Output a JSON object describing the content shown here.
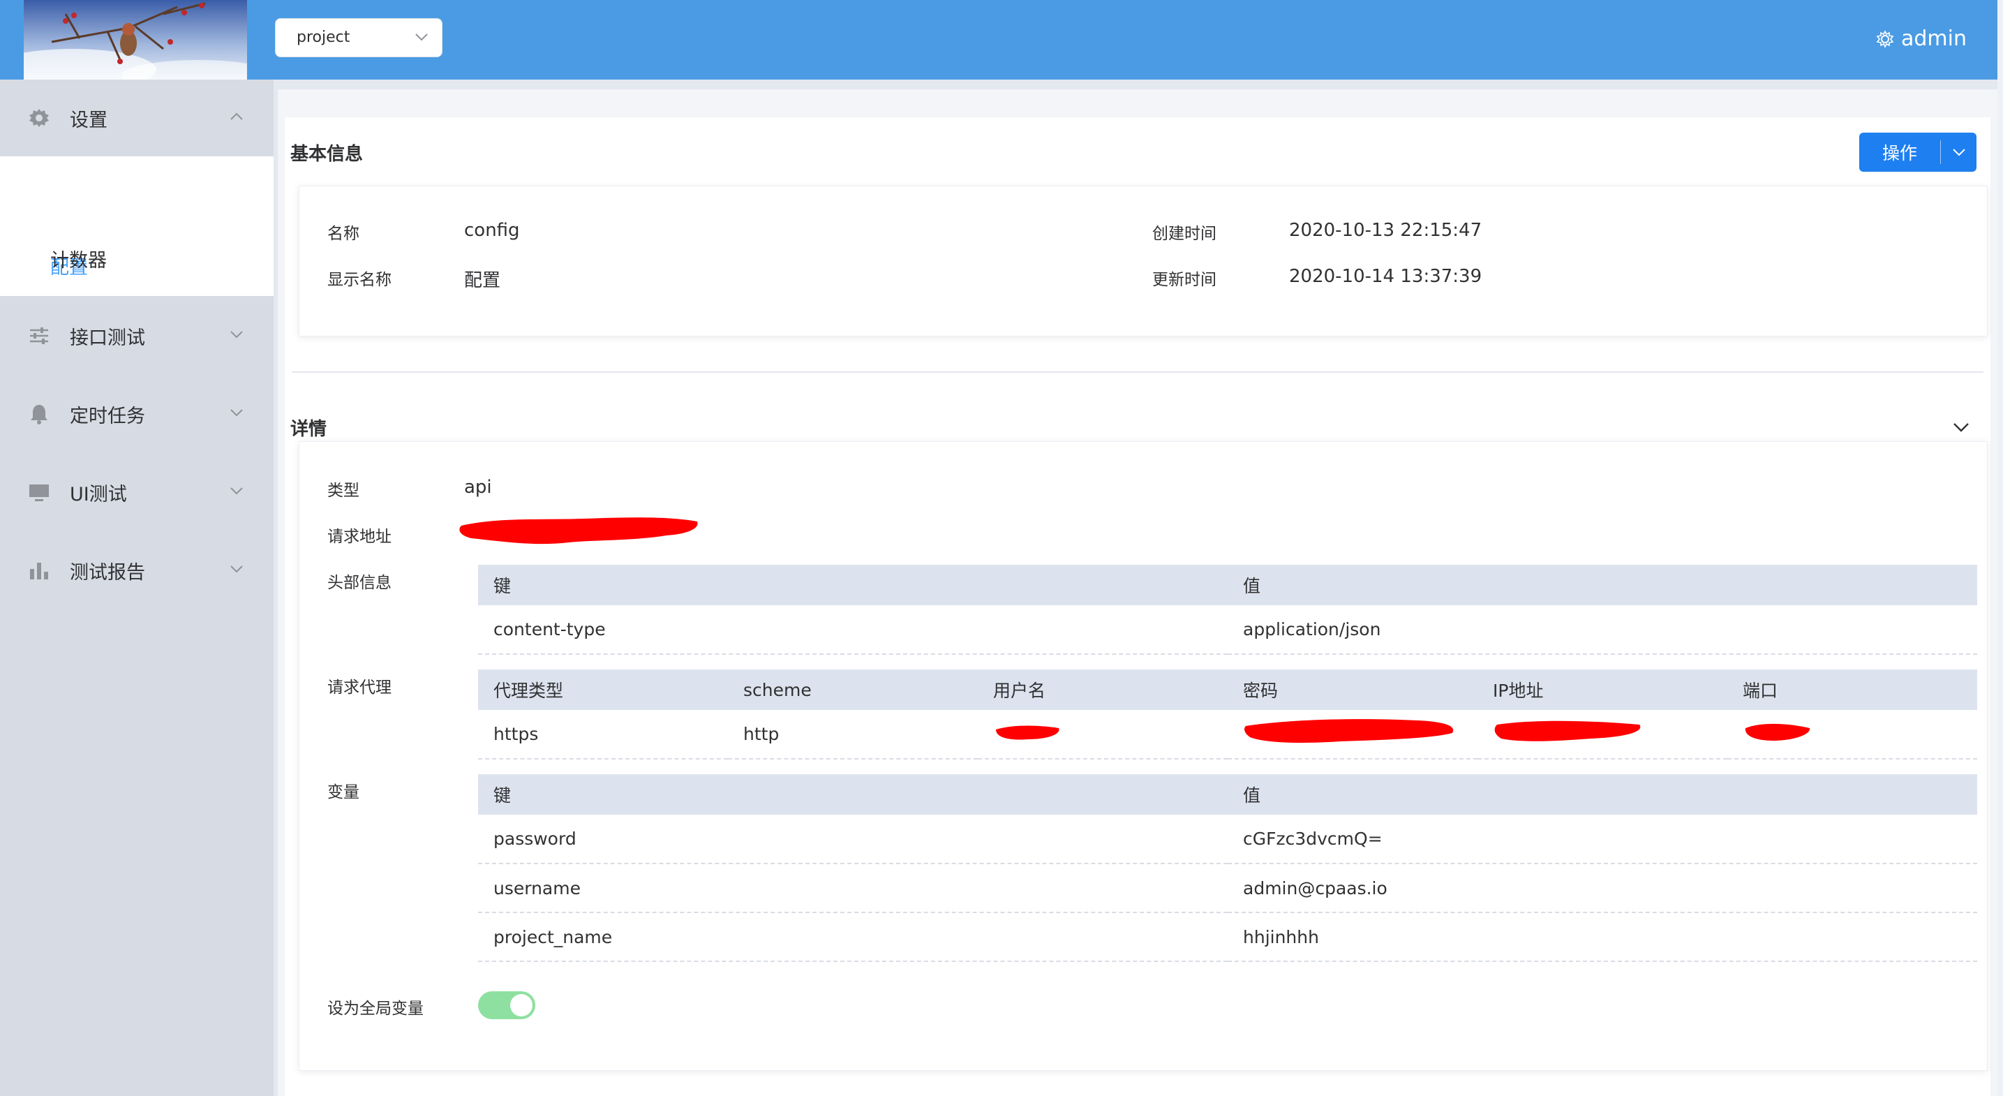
{
  "header": {
    "project_select": "project",
    "user": "admin"
  },
  "sidebar": {
    "groups": [
      {
        "label": "设置",
        "icon": "gear-icon",
        "expanded": true,
        "items": [
          {
            "label": "配置",
            "active": true
          },
          {
            "label": "计数器",
            "active": false
          }
        ]
      },
      {
        "label": "接口测试",
        "icon": "sliders-icon"
      },
      {
        "label": "定时任务",
        "icon": "bell-icon"
      },
      {
        "label": "UI测试",
        "icon": "monitor-icon"
      },
      {
        "label": "测试报告",
        "icon": "bar-chart-icon"
      }
    ]
  },
  "basic": {
    "title": "基本信息",
    "op_button": "操作",
    "name_label": "名称",
    "name_value": "config",
    "display_name_label": "显示名称",
    "display_name_value": "配置",
    "created_label": "创建时间",
    "created_value": "2020-10-13 22:15:47",
    "updated_label": "更新时间",
    "updated_value": "2020-10-14 13:37:39"
  },
  "detail": {
    "title": "详情",
    "type_label": "类型",
    "type_value": "api",
    "url_label": "请求地址",
    "headers_label": "头部信息",
    "headers": {
      "columns": [
        "键",
        "值"
      ],
      "rows": [
        [
          "content-type",
          "application/json"
        ]
      ]
    },
    "proxy_label": "请求代理",
    "proxy": {
      "columns": [
        "代理类型",
        "scheme",
        "用户名",
        "密码",
        "IP地址",
        "端口"
      ],
      "rows": [
        [
          "https",
          "http",
          "",
          "",
          "",
          ""
        ]
      ]
    },
    "variables_label": "变量",
    "variables": {
      "columns": [
        "键",
        "值"
      ],
      "rows": [
        [
          "password",
          "cGFzc3dvcmQ="
        ],
        [
          "username",
          "admin@cpaas.io"
        ],
        [
          "project_name",
          "hhjinhhh"
        ]
      ]
    },
    "global_label": "设为全局变量",
    "global_enabled": true
  },
  "colors": {
    "header": "#4a9be4",
    "sidebar": "#d7dbe3",
    "accent": "#409eff",
    "button": "#1e7ff0",
    "switch_on": "#8ee0a0",
    "redaction": "#ff0000"
  }
}
